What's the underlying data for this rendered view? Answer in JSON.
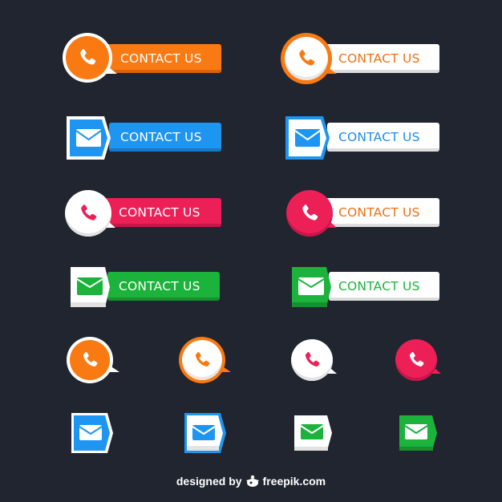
{
  "colors": {
    "background": "#21252f",
    "orange": "#f97a12",
    "blue": "#1e95f0",
    "pink": "#ec1f57",
    "green": "#1bb33b",
    "white": "#ffffff"
  },
  "buttons": [
    {
      "label": "CONTACT US",
      "icon": "phone-icon",
      "style": "orange-filled"
    },
    {
      "label": "CONTACT US",
      "icon": "phone-icon",
      "style": "orange-outline"
    },
    {
      "label": "CONTACT US",
      "icon": "mail-icon",
      "style": "blue-filled"
    },
    {
      "label": "CONTACT US",
      "icon": "mail-icon",
      "style": "blue-outline"
    },
    {
      "label": "CONTACT US",
      "icon": "phone-icon",
      "style": "pink-filled"
    },
    {
      "label": "CONTACT US",
      "icon": "phone-icon",
      "style": "pink-outline"
    },
    {
      "label": "CONTACT US",
      "icon": "mail-icon",
      "style": "green-filled"
    },
    {
      "label": "CONTACT US",
      "icon": "mail-icon",
      "style": "green-outline"
    }
  ],
  "small_icons": [
    {
      "icon": "phone-icon",
      "style": "orange-filled"
    },
    {
      "icon": "phone-icon",
      "style": "orange-outline"
    },
    {
      "icon": "phone-icon",
      "style": "pink-outline"
    },
    {
      "icon": "phone-icon",
      "style": "pink-filled"
    },
    {
      "icon": "mail-icon",
      "style": "blue-filled"
    },
    {
      "icon": "mail-icon",
      "style": "blue-outline"
    },
    {
      "icon": "mail-icon",
      "style": "green-outline"
    },
    {
      "icon": "mail-icon",
      "style": "green-filled"
    }
  ],
  "footer": {
    "prefix": "designed by",
    "brand": "freepik.com"
  }
}
